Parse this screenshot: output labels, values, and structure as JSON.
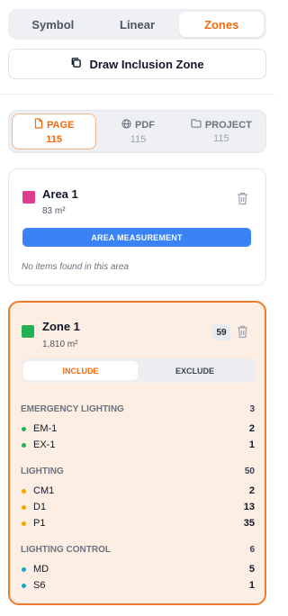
{
  "top_tabs": [
    {
      "label": "Symbol",
      "active": false
    },
    {
      "label": "Linear",
      "active": false
    },
    {
      "label": "Zones",
      "active": true
    }
  ],
  "draw_button": {
    "label": "Draw Inclusion Zone",
    "icon": "copy-icon"
  },
  "scope_tabs": [
    {
      "label": "PAGE",
      "count": "115",
      "icon": "file-icon",
      "active": true
    },
    {
      "label": "PDF",
      "count": "115",
      "icon": "globe-icon",
      "active": false
    },
    {
      "label": "PROJECT",
      "count": "115",
      "icon": "folder-icon",
      "active": false
    }
  ],
  "area_card": {
    "title": "Area 1",
    "area": "83 m²",
    "color": "#e23c8f",
    "button_label": "AREA MEASUREMENT",
    "empty_text": "No items found in this area"
  },
  "zone_card": {
    "title": "Zone 1",
    "area": "1,810 m²",
    "color": "#21b154",
    "badge": "59",
    "toggle": {
      "include": "INCLUDE",
      "exclude": "EXCLUDE",
      "active": "include"
    },
    "groups": [
      {
        "name": "EMERGENCY LIGHTING",
        "count": "3",
        "items": [
          {
            "name": "EM-1",
            "count": "2",
            "color": "#21b154"
          },
          {
            "name": "EX-1",
            "count": "1",
            "color": "#21b154"
          }
        ]
      },
      {
        "name": "LIGHTING",
        "count": "50",
        "items": [
          {
            "name": "CM1",
            "count": "2",
            "color": "#f0a500"
          },
          {
            "name": "D1",
            "count": "13",
            "color": "#f0a500"
          },
          {
            "name": "P1",
            "count": "35",
            "color": "#f0a500"
          }
        ]
      },
      {
        "name": "LIGHTING CONTROL",
        "count": "6",
        "items": [
          {
            "name": "MD",
            "count": "5",
            "color": "#17a9c4"
          },
          {
            "name": "S6",
            "count": "1",
            "color": "#17a9c4"
          }
        ]
      }
    ]
  },
  "colors": {
    "accent": "#f46a0b",
    "primary_button": "#3b82f6"
  }
}
